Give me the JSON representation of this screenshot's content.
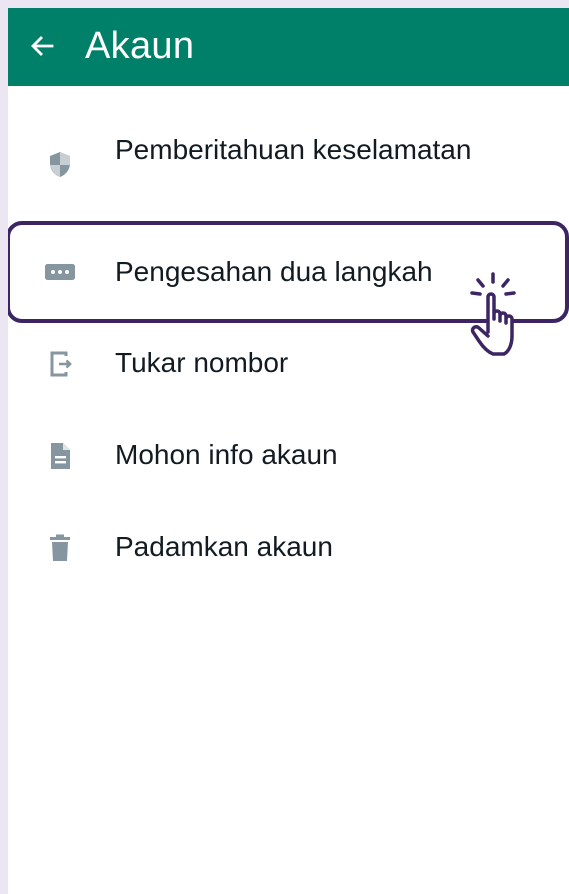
{
  "header": {
    "title": "Akaun",
    "background": "#008069"
  },
  "menu": {
    "items": [
      {
        "label": "Pemberitahuan keselamatan",
        "icon": "shield-icon"
      },
      {
        "label": "Pengesahan dua langkah",
        "icon": "password-dots-icon"
      },
      {
        "label": "Tukar nombor",
        "icon": "phone-transfer-icon"
      },
      {
        "label": "Mohon info akaun",
        "icon": "document-icon"
      },
      {
        "label": "Padamkan akaun",
        "icon": "trash-icon"
      }
    ]
  },
  "highlight": {
    "target": "Pengesahan dua langkah",
    "color": "#3d2563",
    "pointer_icon": "tap-hand-icon"
  },
  "colors": {
    "icon": "#8696a0",
    "text": "#111b21",
    "page_border": "#ece6f2"
  }
}
